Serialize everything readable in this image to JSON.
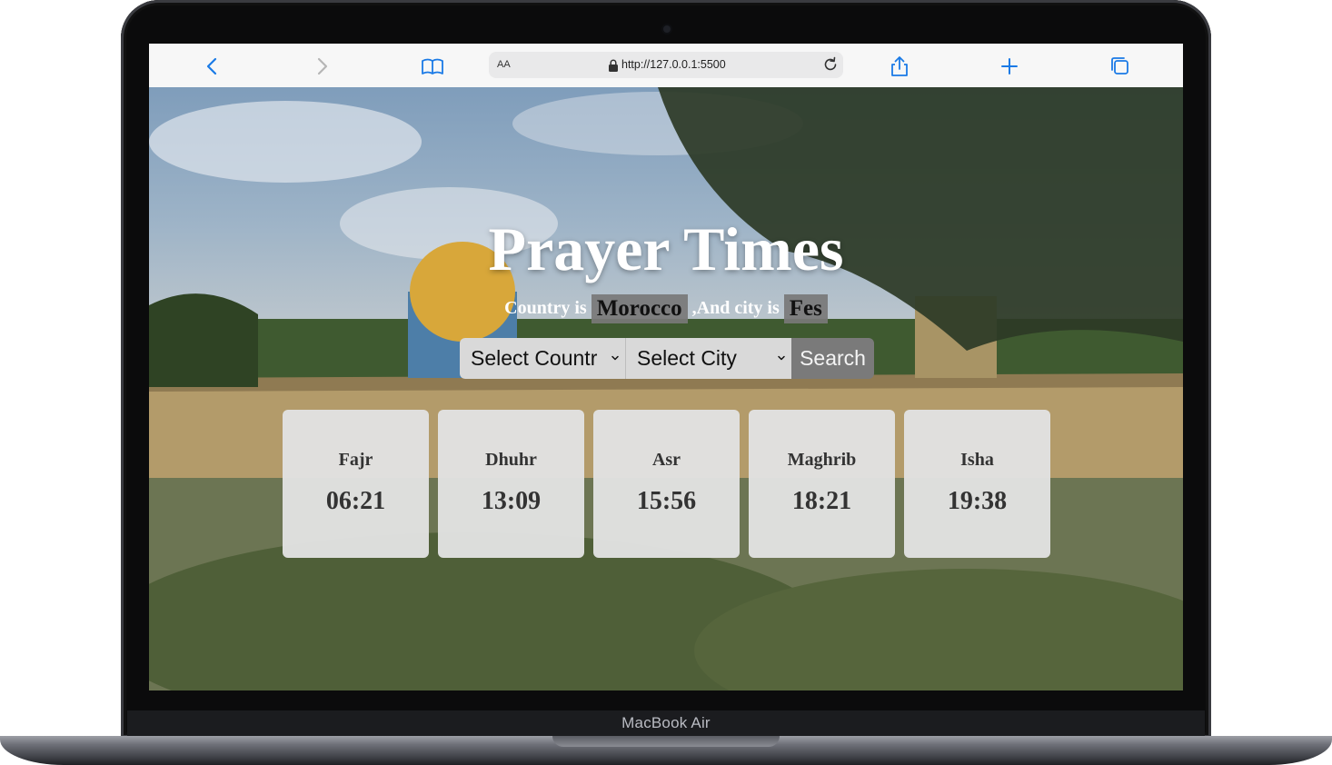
{
  "device": {
    "label": "MacBook Air"
  },
  "browser": {
    "reader_label": "AA",
    "url": "http://127.0.0.1:5500"
  },
  "page": {
    "title": "Prayer Times",
    "country_prefix": "Country is",
    "country": "Morocco",
    "city_prefix": ",And city is",
    "city": "Fes",
    "country_select": "Select Countr",
    "city_select": "Select City",
    "search_label": "Search",
    "prayers": [
      {
        "name": "Fajr",
        "time": "06:21"
      },
      {
        "name": "Dhuhr",
        "time": "13:09"
      },
      {
        "name": "Asr",
        "time": "15:56"
      },
      {
        "name": "Maghrib",
        "time": "18:21"
      },
      {
        "name": "Isha",
        "time": "19:38"
      }
    ]
  },
  "colors": {
    "accent": "#1a7ae6",
    "card_bg": "#e1e1e1",
    "chip_bg": "#787878",
    "search_bg": "#7a7a7a"
  }
}
